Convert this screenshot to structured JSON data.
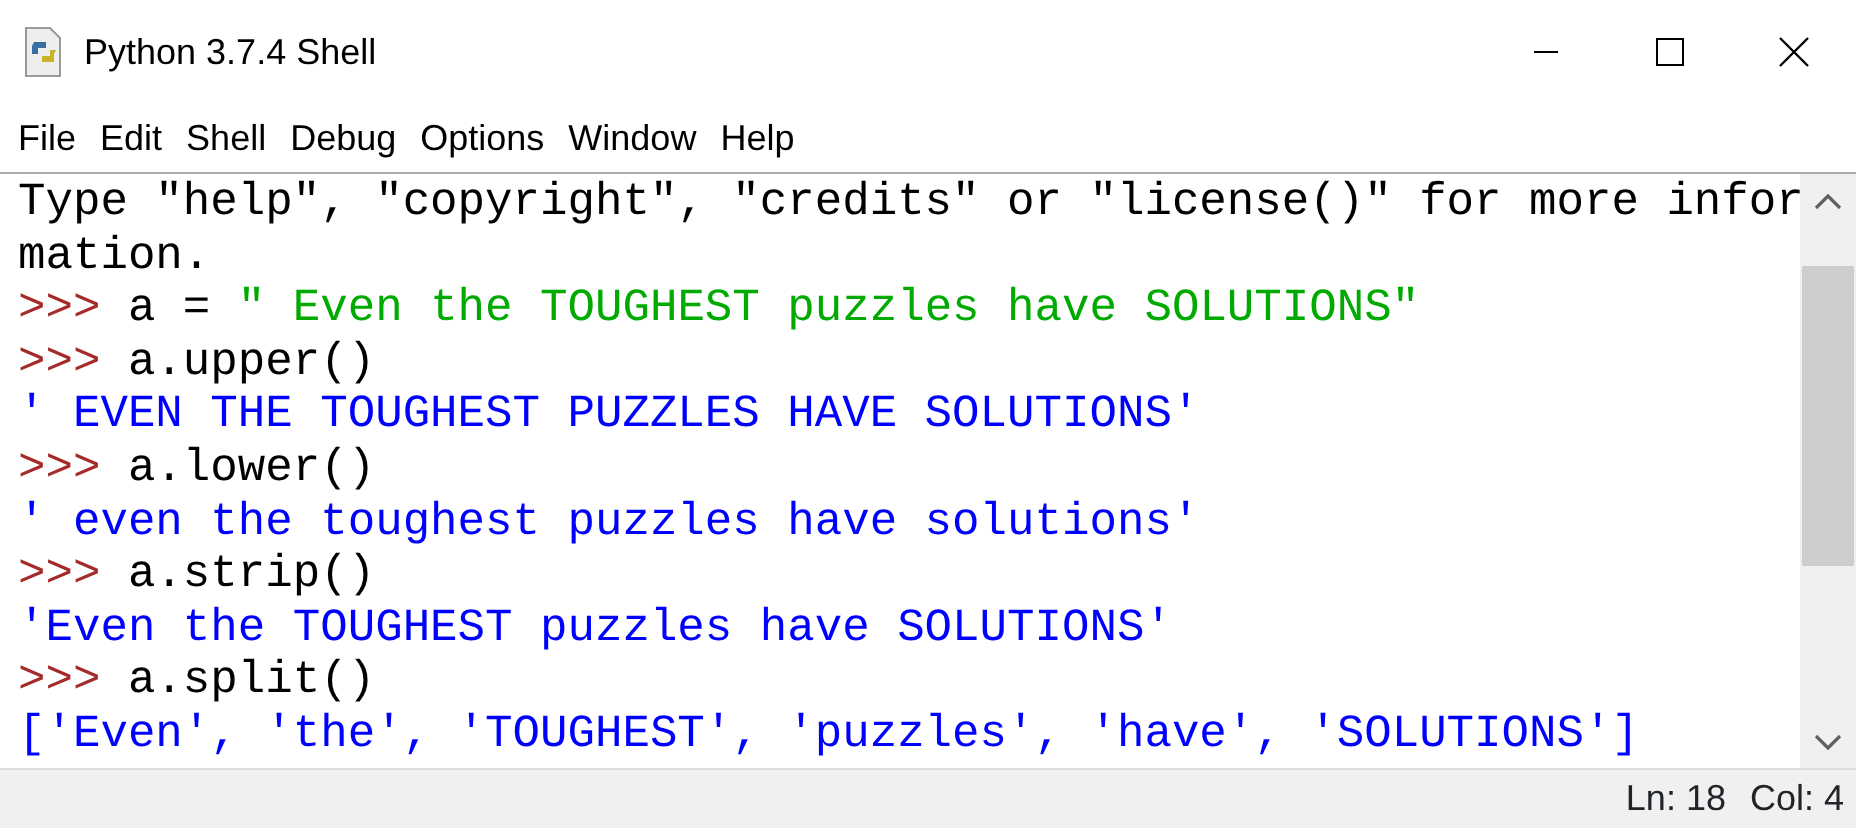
{
  "window": {
    "title": "Python 3.7.4 Shell"
  },
  "menu": [
    "File",
    "Edit",
    "Shell",
    "Debug",
    "Options",
    "Window",
    "Help"
  ],
  "lines": [
    {
      "segments": [
        {
          "kind": "text",
          "text": "Type \"help\", \"copyright\", \"credits\" or \"license()\" for more infor"
        }
      ]
    },
    {
      "segments": [
        {
          "kind": "text",
          "text": "mation."
        }
      ]
    },
    {
      "segments": [
        {
          "kind": "prompt",
          "text": ">>> "
        },
        {
          "kind": "code",
          "text": "a = "
        },
        {
          "kind": "string",
          "text": "\" Even the TOUGHEST puzzles have SOLUTIONS\""
        }
      ]
    },
    {
      "segments": [
        {
          "kind": "prompt",
          "text": ">>> "
        },
        {
          "kind": "code",
          "text": "a.upper()"
        }
      ]
    },
    {
      "segments": [
        {
          "kind": "output",
          "text": "' EVEN THE TOUGHEST PUZZLES HAVE SOLUTIONS'"
        }
      ]
    },
    {
      "segments": [
        {
          "kind": "prompt",
          "text": ">>> "
        },
        {
          "kind": "code",
          "text": "a.lower()"
        }
      ]
    },
    {
      "segments": [
        {
          "kind": "output",
          "text": "' even the toughest puzzles have solutions'"
        }
      ]
    },
    {
      "segments": [
        {
          "kind": "prompt",
          "text": ">>> "
        },
        {
          "kind": "code",
          "text": "a.strip()"
        }
      ]
    },
    {
      "segments": [
        {
          "kind": "output",
          "text": "'Even the TOUGHEST puzzles have SOLUTIONS'"
        }
      ]
    },
    {
      "segments": [
        {
          "kind": "prompt",
          "text": ">>> "
        },
        {
          "kind": "code",
          "text": "a.split()"
        }
      ]
    },
    {
      "segments": [
        {
          "kind": "output",
          "text": "['Even', 'the', 'TOUGHEST', 'puzzles', 'have', 'SOLUTIONS']"
        }
      ]
    }
  ],
  "status_bar": {
    "line": "Ln: 18",
    "column": "Col: 4"
  }
}
